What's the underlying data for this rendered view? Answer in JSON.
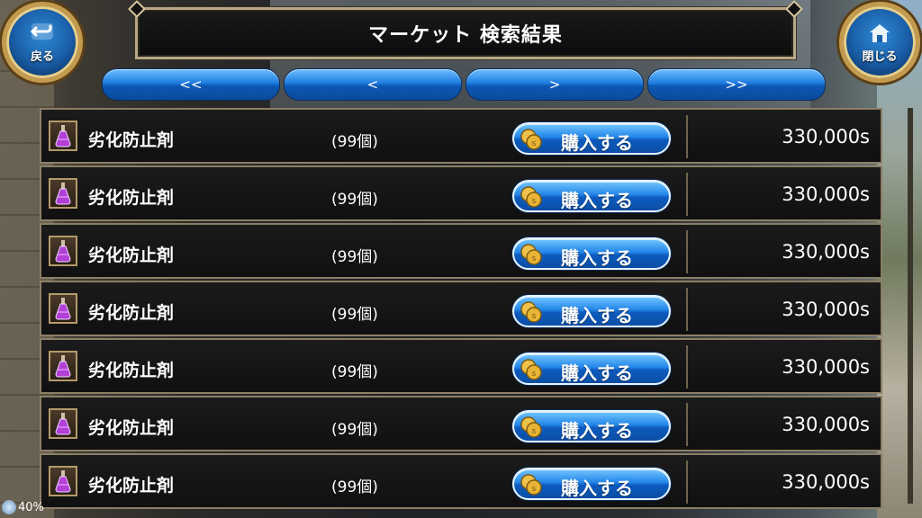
{
  "header": {
    "title": "マーケット 検索結果",
    "back_label": "戻る",
    "close_label": "閉じる",
    "back_icon": "back-arrow-icon",
    "close_icon": "home-icon"
  },
  "pager": {
    "first": "<<",
    "prev": "<",
    "next": ">",
    "last": ">>"
  },
  "listings": [
    {
      "name": "劣化防止剤",
      "quantity": "(99個)",
      "buy_label": "購入する",
      "price": "330,000s"
    },
    {
      "name": "劣化防止剤",
      "quantity": "(99個)",
      "buy_label": "購入する",
      "price": "330,000s"
    },
    {
      "name": "劣化防止剤",
      "quantity": "(99個)",
      "buy_label": "購入する",
      "price": "330,000s"
    },
    {
      "name": "劣化防止剤",
      "quantity": "(99個)",
      "buy_label": "購入する",
      "price": "330,000s"
    },
    {
      "name": "劣化防止剤",
      "quantity": "(99個)",
      "buy_label": "購入する",
      "price": "330,000s"
    },
    {
      "name": "劣化防止剤",
      "quantity": "(99個)",
      "buy_label": "購入する",
      "price": "330,000s"
    },
    {
      "name": "劣化防止剤",
      "quantity": "(99個)",
      "buy_label": "購入する",
      "price": "330,000s"
    }
  ],
  "status": {
    "battery": "40%"
  },
  "colors": {
    "button_blue": "#1f7de0",
    "frame_gold": "#b7a889",
    "row_bg": "#151515"
  }
}
